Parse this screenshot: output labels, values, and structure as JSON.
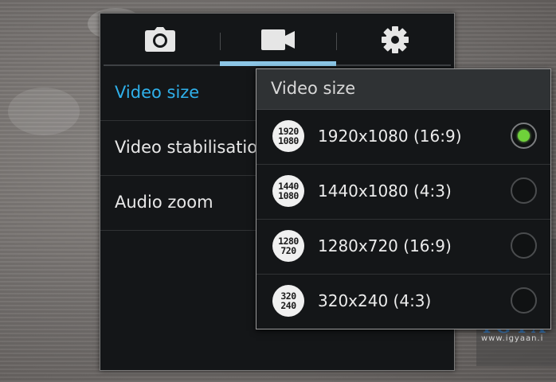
{
  "background": {
    "watermark": {
      "logo": "IGYA",
      "url": "www.igyaan.i"
    }
  },
  "tabs": [
    {
      "icon": "camera-icon",
      "selected": false
    },
    {
      "icon": "video-camera-icon",
      "selected": true
    },
    {
      "icon": "gear-icon",
      "selected": false
    }
  ],
  "settings": {
    "items": [
      {
        "label": "Video size",
        "active": true
      },
      {
        "label": "Video stabilisatio",
        "active": false
      },
      {
        "label": "Audio zoom",
        "active": false
      }
    ]
  },
  "popup": {
    "title": "Video size",
    "options": [
      {
        "icon_top": "1920",
        "icon_bottom": "1080",
        "label": "1920x1080 (16:9)",
        "selected": true
      },
      {
        "icon_top": "1440",
        "icon_bottom": "1080",
        "label": "1440x1080 (4:3)",
        "selected": false
      },
      {
        "icon_top": "1280",
        "icon_bottom": "720",
        "label": "1280x720 (16:9)",
        "selected": false
      },
      {
        "icon_top": "320",
        "icon_bottom": "240",
        "label": "320x240 (4:3)",
        "selected": false
      }
    ]
  },
  "colors": {
    "accent_blue": "#2fb0ea",
    "tab_indicator": "#8cc6e6",
    "radio_selected": "#6fd23a"
  }
}
